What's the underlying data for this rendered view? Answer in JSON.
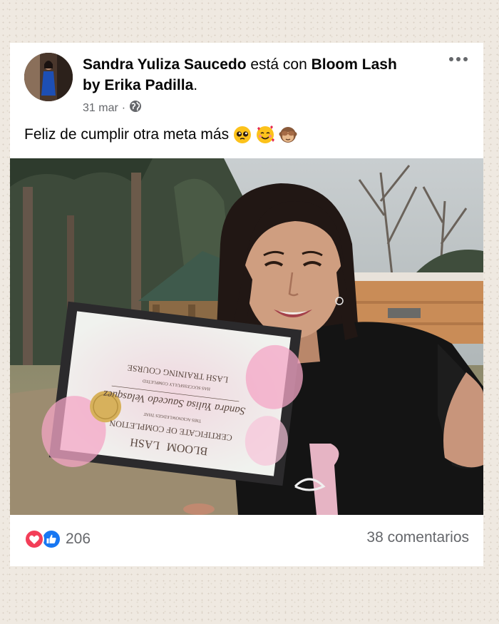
{
  "post": {
    "author": "Sandra Yuliza Saucedo",
    "connector": " está con ",
    "tagged": "Bloom Lash by Erika Padilla",
    "period": ".",
    "date": "31 mar",
    "separator": "·",
    "audience_icon": "globe-icon",
    "caption": "Feliz de cumplir otra meta más",
    "emojis": [
      "pleading-face-emoji",
      "smiling-face-with-hearts-emoji",
      "see-no-evil-monkey-emoji"
    ],
    "more_icon": "more-options-icon"
  },
  "certificate": {
    "brand": "BLOOM",
    "brand2": "LASH",
    "title": "CERTIFICATE OF COMPLETION",
    "acknowledge": "THIS ACKNOWLEDGES THAT",
    "name": "Sandra Yulisa Saucedo Velasquez",
    "completed": "HAS SUCCESSFULLY COMPLETED",
    "course": "LASH TRAINING COURSE"
  },
  "footer": {
    "reaction_icons": [
      "love-reaction-icon",
      "like-reaction-icon"
    ],
    "reaction_count": "206",
    "comments": "38 comentarios"
  },
  "colors": {
    "like_blue": "#1877f2",
    "love_red": "#f33e58",
    "text_secondary": "#65676b"
  }
}
